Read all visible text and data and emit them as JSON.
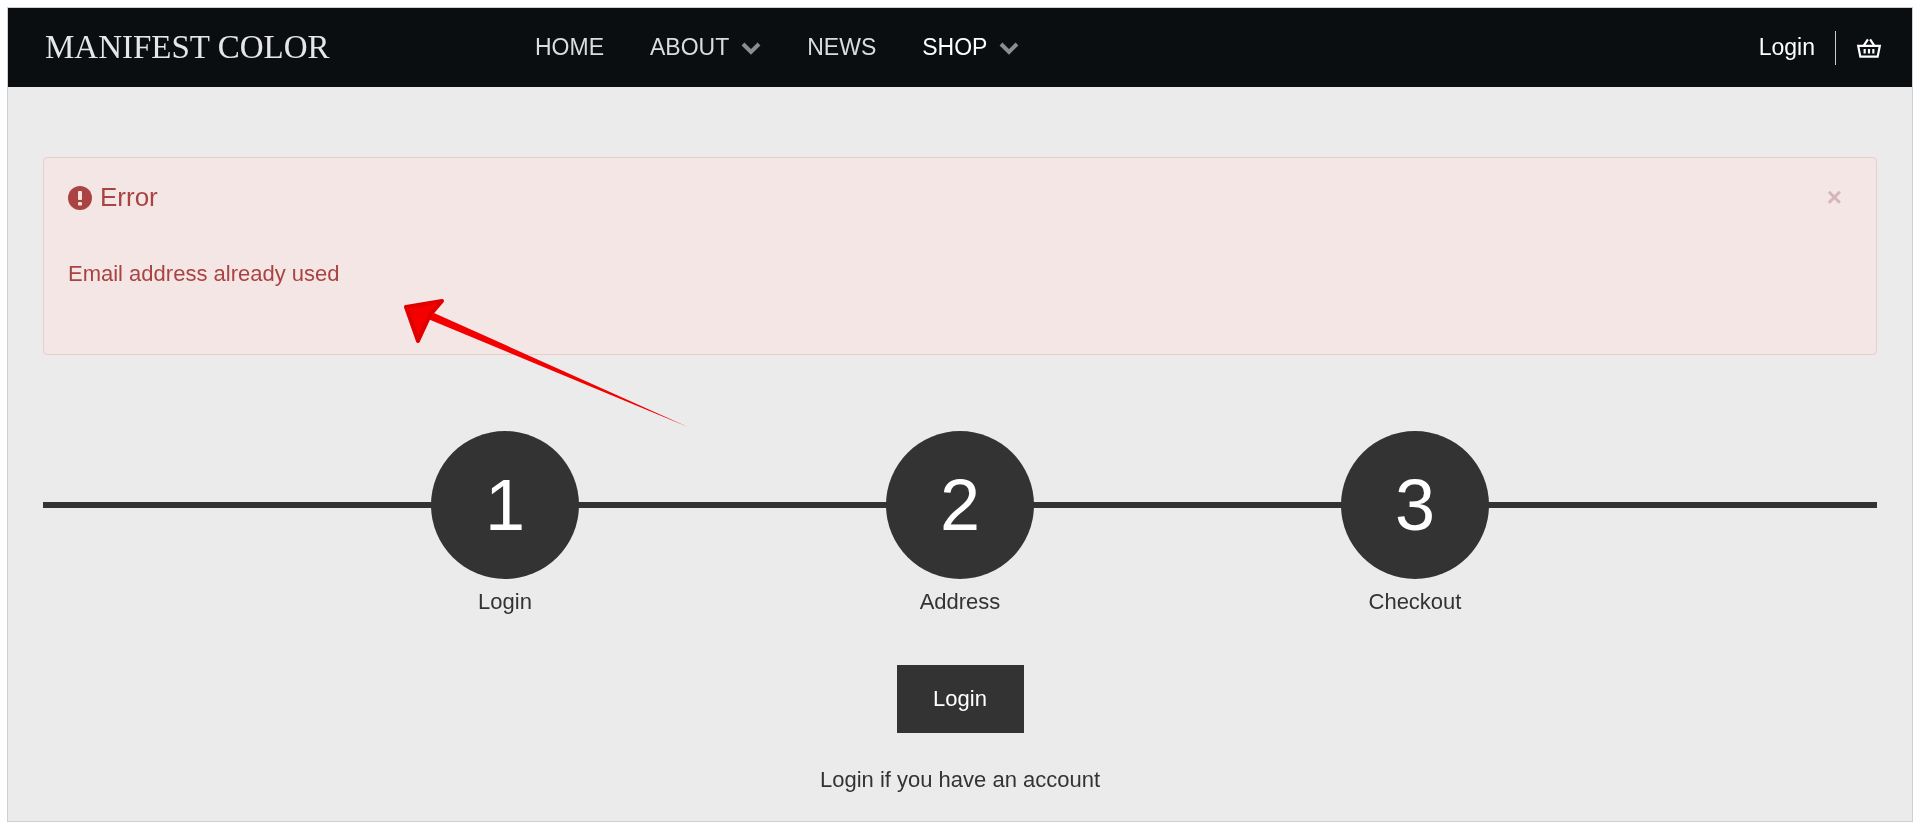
{
  "header": {
    "logo": "MANIFEST COLOR",
    "nav": [
      {
        "label": "HOME",
        "dropdown": false,
        "selected": false
      },
      {
        "label": "ABOUT",
        "dropdown": true,
        "selected": false
      },
      {
        "label": "NEWS",
        "dropdown": false,
        "selected": false
      },
      {
        "label": "SHOP",
        "dropdown": true,
        "selected": true
      }
    ],
    "login": "Login"
  },
  "alert": {
    "title": "Error",
    "message": "Email address already used",
    "close": "×"
  },
  "steps": [
    {
      "number": "1",
      "label": "Login"
    },
    {
      "number": "2",
      "label": "Address"
    },
    {
      "number": "3",
      "label": "Checkout"
    }
  ],
  "login_button": "Login",
  "hint": "Login if you have an account"
}
